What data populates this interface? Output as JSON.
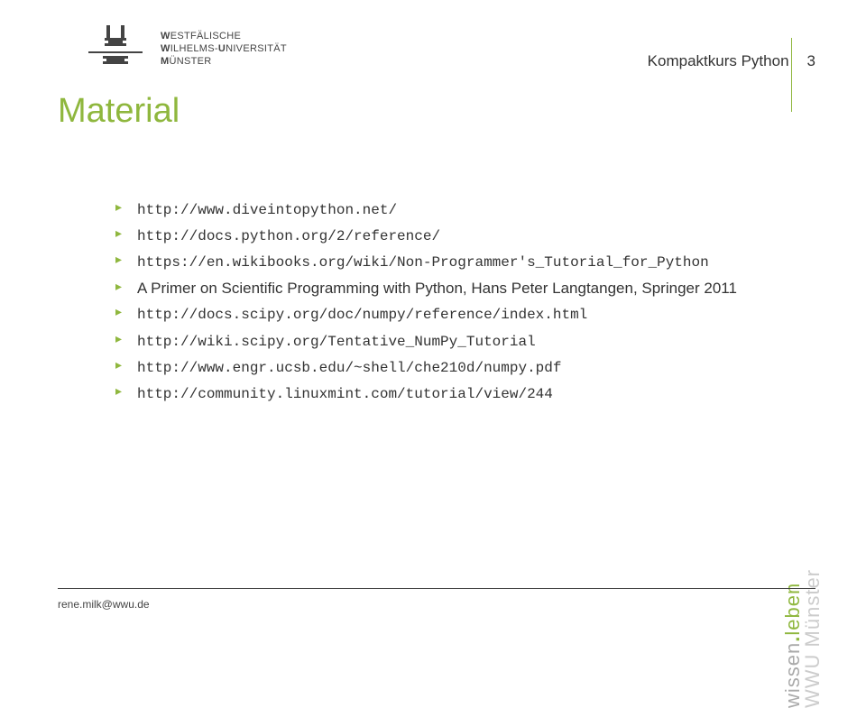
{
  "header": {
    "university": {
      "line1_bold": "W",
      "line1_rest": "ESTFÄLISCHE",
      "line2_bold": "W",
      "line2_rest": "ILHELMS-",
      "line2b_bold": "U",
      "line2b_rest": "NIVERSITÄT",
      "line3_bold": "M",
      "line3_rest": "ÜNSTER"
    },
    "course_title": "Kompaktkurs Python",
    "page_number": "3"
  },
  "title": "Material",
  "bullets": [
    {
      "text": "http://www.diveintopython.net/",
      "mono": true
    },
    {
      "text": "http://docs.python.org/2/reference/",
      "mono": true
    },
    {
      "text": "https://en.wikibooks.org/wiki/Non-Programmer's_Tutorial_for_Python",
      "mono": true
    },
    {
      "text": "A Primer on Scientific Programming with Python, Hans Peter Langtangen, Springer 2011",
      "mono": false
    },
    {
      "text": "http://docs.scipy.org/doc/numpy/reference/index.html",
      "mono": true
    },
    {
      "text": "http://wiki.scipy.org/Tentative_NumPy_Tutorial",
      "mono": true
    },
    {
      "text": "http://www.engr.ucsb.edu/~shell/che210d/numpy.pdf",
      "mono": true
    },
    {
      "text": "http://community.linuxmint.com/tutorial/view/244",
      "mono": true
    }
  ],
  "footer": {
    "email": "rene.milk@wwu.de"
  },
  "sidebar": {
    "wissen": "wissen",
    "leben": "leben",
    "wwu": "WWU Münster"
  }
}
